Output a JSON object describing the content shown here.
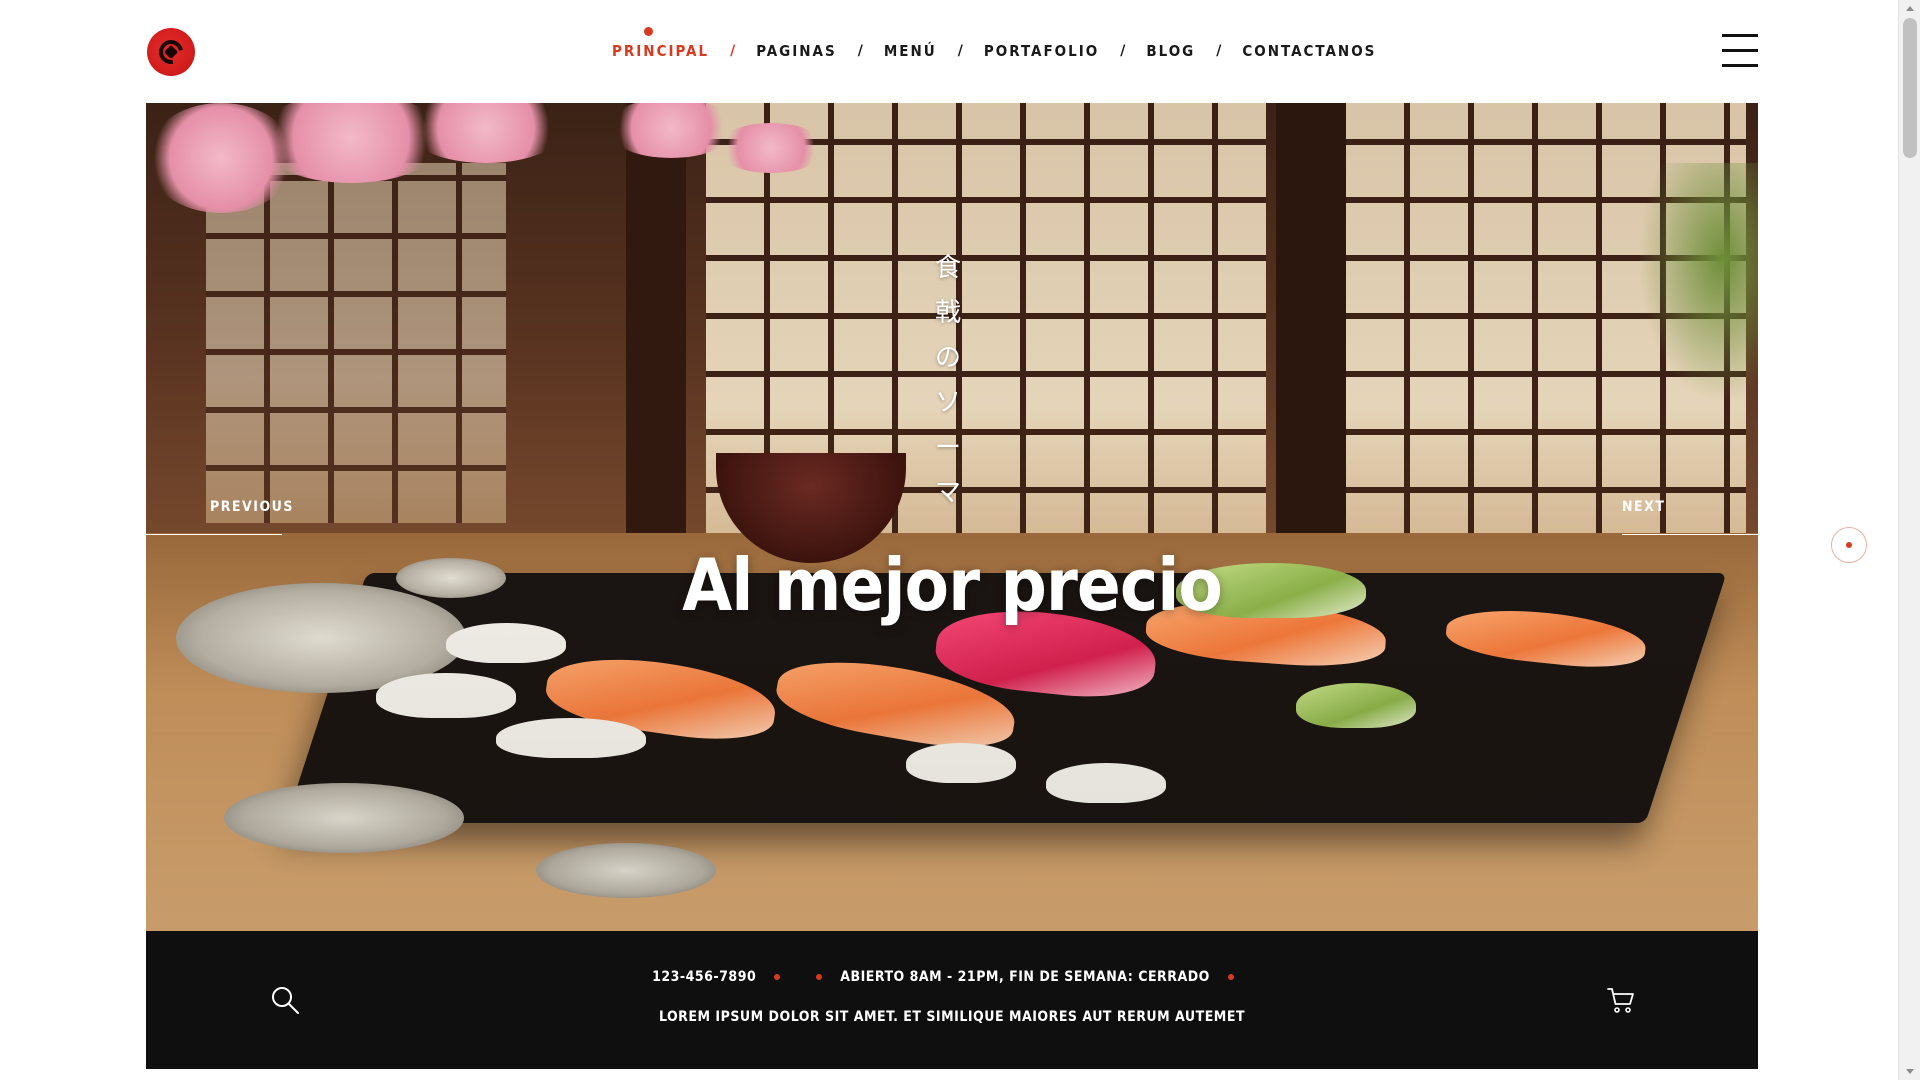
{
  "header": {
    "logo_name": "brand-logo",
    "nav": [
      {
        "label": "PRINCIPAL",
        "active": true
      },
      {
        "label": "PAGINAS",
        "active": false
      },
      {
        "label": "MENÚ",
        "active": false
      },
      {
        "label": "PORTAFOLIO",
        "active": false
      },
      {
        "label": "BLOG",
        "active": false
      },
      {
        "label": "CONTACTANOS",
        "active": false
      }
    ],
    "separator": "/",
    "menu_icon": "hamburger-menu-icon"
  },
  "hero": {
    "vertical_text": [
      "食",
      "戟",
      "の",
      "ソ",
      "ー",
      "マ"
    ],
    "title": "Al mejor precio",
    "prev_label": "PREVIOUS",
    "next_label": "NEXT"
  },
  "infobar": {
    "phone": "123-456-7890",
    "hours": "ABIERTO 8AM - 21PM, FIN DE SEMANA: CERRADO",
    "tagline": "LOREM IPSUM DOLOR SIT AMET. ET SIMILIQUE MAIORES AUT RERUM AUTEMET",
    "search_icon": "search-icon",
    "cart_icon": "cart-icon"
  },
  "colors": {
    "accent": "#d83a1f",
    "infobar_bg": "#0f0f0f",
    "text_dark": "#1a1a1a"
  }
}
